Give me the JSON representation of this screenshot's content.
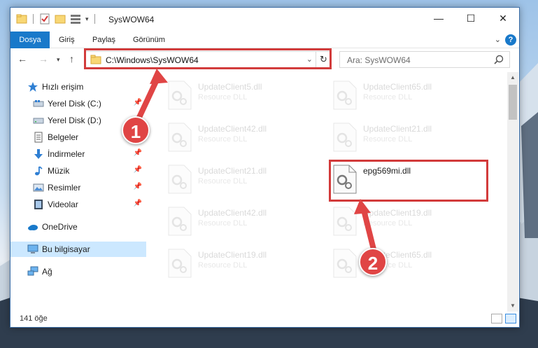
{
  "window": {
    "title": "SysWOW64",
    "controls": {
      "minimize": "—",
      "maximize": "☐",
      "close": "✕"
    }
  },
  "ribbon": {
    "tabs": [
      {
        "label": "Dosya",
        "active": true
      },
      {
        "label": "Giriş"
      },
      {
        "label": "Paylaş"
      },
      {
        "label": "Görünüm"
      }
    ],
    "help": "?"
  },
  "address": {
    "path": "C:\\Windows\\SysWOW64",
    "search_placeholder": "Ara: SysWOW64"
  },
  "sidebar": {
    "items": [
      {
        "label": "Hızlı erişim",
        "icon": "star-icon"
      },
      {
        "label": "Yerel Disk (C:)",
        "icon": "drive-icon",
        "pinned": true
      },
      {
        "label": "Yerel Disk (D:)",
        "icon": "drive-icon"
      },
      {
        "label": "Belgeler",
        "icon": "documents-icon"
      },
      {
        "label": "İndirmeler",
        "icon": "download-icon",
        "pinned": true
      },
      {
        "label": "Müzik",
        "icon": "music-icon",
        "pinned": true
      },
      {
        "label": "Resimler",
        "icon": "pictures-icon",
        "pinned": true
      },
      {
        "label": "Videolar",
        "icon": "videos-icon",
        "pinned": true
      },
      {
        "label": "OneDrive",
        "icon": "cloud-icon"
      },
      {
        "label": "Bu bilgisayar",
        "icon": "computer-icon",
        "selected": true
      },
      {
        "label": "Ağ",
        "icon": "network-icon"
      }
    ]
  },
  "files": [
    {
      "name": "UpdateClient5.dll",
      "type": "Resource DLL",
      "faded": true
    },
    {
      "name": "UpdateClient65.dll",
      "type": "Resource DLL",
      "faded": true
    },
    {
      "name": "UpdateClient42.dll",
      "type": "Resource DLL",
      "faded": true
    },
    {
      "name": "UpdateClient21.dll",
      "type": "Resource DLL",
      "faded": true
    },
    {
      "name": "UpdateClient21.dll",
      "type": "Resource DLL",
      "faded": true
    },
    {
      "name": "epg569mi.dll",
      "type": "",
      "faded": false
    },
    {
      "name": "UpdateClient42.dll",
      "type": "Resource DLL",
      "faded": true
    },
    {
      "name": "UpdateClient19.dll",
      "type": "Resource DLL",
      "faded": true
    },
    {
      "name": "UpdateClient19.dll",
      "type": "Resource DLL",
      "faded": true
    },
    {
      "name": "UpdateClient65.dll",
      "type": "Resource DLL",
      "faded": true
    }
  ],
  "status": {
    "item_count": "141 öğe"
  },
  "annotations": {
    "step1": "1",
    "step2": "2",
    "color": "#d23b3b"
  }
}
